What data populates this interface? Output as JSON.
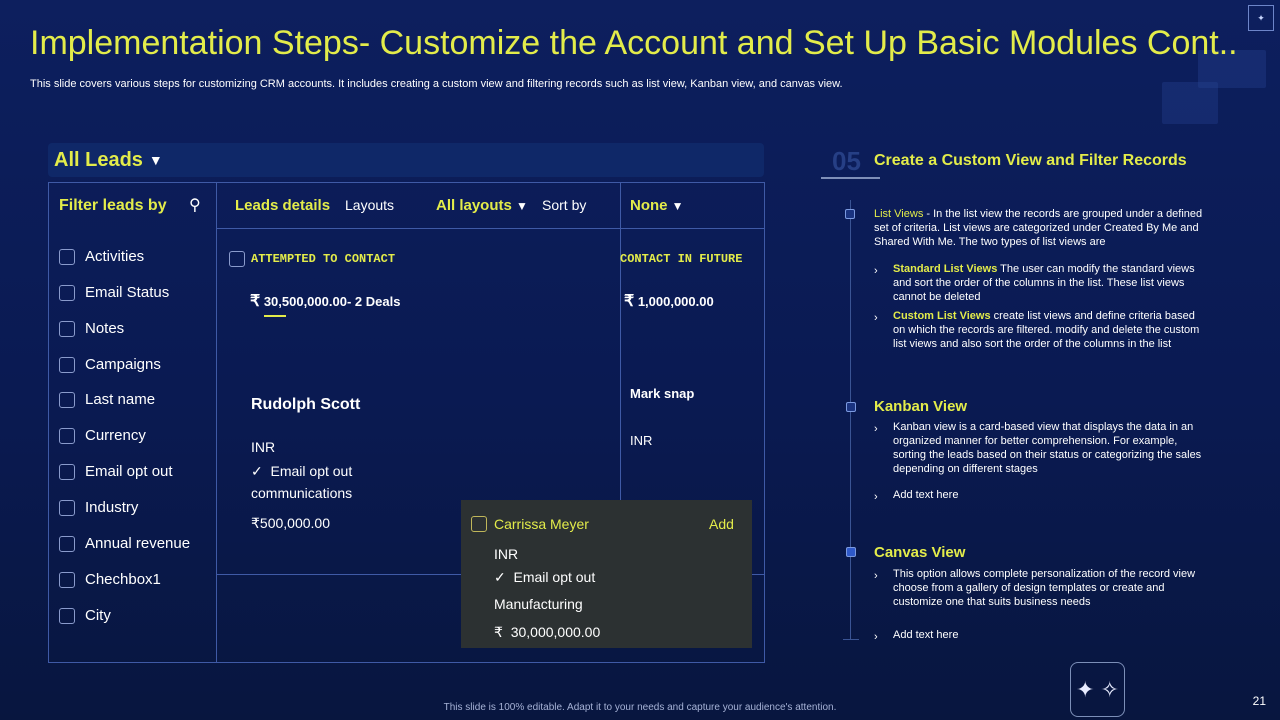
{
  "slide": {
    "title": "Implementation Steps- Customize the Account and Set Up Basic Modules Cont..",
    "subtitle": "This slide covers various steps for customizing CRM accounts. It includes creating a custom view and filtering records such as list view, Kanban view, and canvas view.",
    "footer": "This slide is 100% editable. Adapt it to your needs and capture your audience's attention.",
    "page_number": "21",
    "logo_icon": "sparkle-icon"
  },
  "crm": {
    "view_title": "All Leads",
    "filter_header": "Filter leads by",
    "filters": [
      "Activities",
      "Email Status",
      "Notes",
      "Campaigns",
      "Last name",
      "Currency",
      "Email opt out",
      "Industry",
      "Annual revenue",
      "Chechbox1",
      "City"
    ],
    "toolbar": {
      "leads_details": "Leads details",
      "layouts": "Layouts",
      "all_layouts": "All layouts",
      "sort_by": "Sort by",
      "none": "None"
    },
    "columns": [
      {
        "header": "ATTEMPTED  TO CONTACT",
        "amount": "30,500,000.00- 2  Deals"
      },
      {
        "header": "CONTACT  IN  FUTURE",
        "amount": "1,000,000.00"
      }
    ],
    "card1": {
      "name": "Rudolph Scott",
      "currency": "INR",
      "email_opt": "Email opt out",
      "email_opt_line2": "communications",
      "amount": "500,000.00"
    },
    "card2": {
      "name": "Mark snap",
      "currency": "INR"
    },
    "popup": {
      "name": "Carrissa Meyer",
      "add": "Add",
      "currency": "INR",
      "email_opt": "Email opt out",
      "industry": "Manufacturing",
      "amount": "30,000,000.00"
    },
    "rupee": "₹",
    "check": "✓"
  },
  "steps": {
    "number": "05",
    "title": "Create a Custom View and Filter Records",
    "list_views": {
      "label": "List Views",
      "text": " - In the list view the records are grouped under a defined set of criteria. List views are categorized under Created By Me and Shared With Me. The two types of list views are",
      "items": [
        {
          "label": "Standard List Views",
          "text": " The user can modify the standard views and sort the order of the columns in the list. These list views cannot be deleted"
        },
        {
          "label": "Custom List Views",
          "text": " create list views and define criteria based on which the records are filtered. modify and delete the custom list views and also sort the order of the columns in the list"
        }
      ]
    },
    "kanban": {
      "title": "Kanban View",
      "items": [
        "Kanban view is a card-based view that displays the data in an organized manner for better comprehension. For example, sorting the leads based on their status or categorizing the sales depending on different stages",
        "Add text here"
      ]
    },
    "canvas": {
      "title": "Canvas View",
      "items": [
        "This option allows complete personalization of the record view choose from a gallery of design templates or create and customize one that suits business needs",
        "Add text here"
      ]
    },
    "bullet_glyph": "›"
  }
}
